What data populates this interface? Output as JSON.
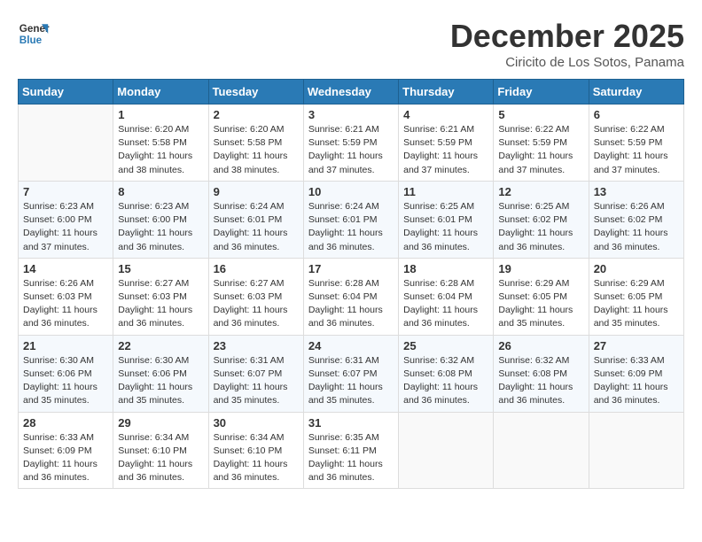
{
  "header": {
    "logo_general": "General",
    "logo_blue": "Blue",
    "month_title": "December 2025",
    "location": "Ciricito de Los Sotos, Panama"
  },
  "days_of_week": [
    "Sunday",
    "Monday",
    "Tuesday",
    "Wednesday",
    "Thursday",
    "Friday",
    "Saturday"
  ],
  "weeks": [
    [
      {
        "day": "",
        "info": ""
      },
      {
        "day": "1",
        "info": "Sunrise: 6:20 AM\nSunset: 5:58 PM\nDaylight: 11 hours\nand 38 minutes."
      },
      {
        "day": "2",
        "info": "Sunrise: 6:20 AM\nSunset: 5:58 PM\nDaylight: 11 hours\nand 38 minutes."
      },
      {
        "day": "3",
        "info": "Sunrise: 6:21 AM\nSunset: 5:59 PM\nDaylight: 11 hours\nand 37 minutes."
      },
      {
        "day": "4",
        "info": "Sunrise: 6:21 AM\nSunset: 5:59 PM\nDaylight: 11 hours\nand 37 minutes."
      },
      {
        "day": "5",
        "info": "Sunrise: 6:22 AM\nSunset: 5:59 PM\nDaylight: 11 hours\nand 37 minutes."
      },
      {
        "day": "6",
        "info": "Sunrise: 6:22 AM\nSunset: 5:59 PM\nDaylight: 11 hours\nand 37 minutes."
      }
    ],
    [
      {
        "day": "7",
        "info": "Sunrise: 6:23 AM\nSunset: 6:00 PM\nDaylight: 11 hours\nand 37 minutes."
      },
      {
        "day": "8",
        "info": "Sunrise: 6:23 AM\nSunset: 6:00 PM\nDaylight: 11 hours\nand 36 minutes."
      },
      {
        "day": "9",
        "info": "Sunrise: 6:24 AM\nSunset: 6:01 PM\nDaylight: 11 hours\nand 36 minutes."
      },
      {
        "day": "10",
        "info": "Sunrise: 6:24 AM\nSunset: 6:01 PM\nDaylight: 11 hours\nand 36 minutes."
      },
      {
        "day": "11",
        "info": "Sunrise: 6:25 AM\nSunset: 6:01 PM\nDaylight: 11 hours\nand 36 minutes."
      },
      {
        "day": "12",
        "info": "Sunrise: 6:25 AM\nSunset: 6:02 PM\nDaylight: 11 hours\nand 36 minutes."
      },
      {
        "day": "13",
        "info": "Sunrise: 6:26 AM\nSunset: 6:02 PM\nDaylight: 11 hours\nand 36 minutes."
      }
    ],
    [
      {
        "day": "14",
        "info": "Sunrise: 6:26 AM\nSunset: 6:03 PM\nDaylight: 11 hours\nand 36 minutes."
      },
      {
        "day": "15",
        "info": "Sunrise: 6:27 AM\nSunset: 6:03 PM\nDaylight: 11 hours\nand 36 minutes."
      },
      {
        "day": "16",
        "info": "Sunrise: 6:27 AM\nSunset: 6:03 PM\nDaylight: 11 hours\nand 36 minutes."
      },
      {
        "day": "17",
        "info": "Sunrise: 6:28 AM\nSunset: 6:04 PM\nDaylight: 11 hours\nand 36 minutes."
      },
      {
        "day": "18",
        "info": "Sunrise: 6:28 AM\nSunset: 6:04 PM\nDaylight: 11 hours\nand 36 minutes."
      },
      {
        "day": "19",
        "info": "Sunrise: 6:29 AM\nSunset: 6:05 PM\nDaylight: 11 hours\nand 35 minutes."
      },
      {
        "day": "20",
        "info": "Sunrise: 6:29 AM\nSunset: 6:05 PM\nDaylight: 11 hours\nand 35 minutes."
      }
    ],
    [
      {
        "day": "21",
        "info": "Sunrise: 6:30 AM\nSunset: 6:06 PM\nDaylight: 11 hours\nand 35 minutes."
      },
      {
        "day": "22",
        "info": "Sunrise: 6:30 AM\nSunset: 6:06 PM\nDaylight: 11 hours\nand 35 minutes."
      },
      {
        "day": "23",
        "info": "Sunrise: 6:31 AM\nSunset: 6:07 PM\nDaylight: 11 hours\nand 35 minutes."
      },
      {
        "day": "24",
        "info": "Sunrise: 6:31 AM\nSunset: 6:07 PM\nDaylight: 11 hours\nand 35 minutes."
      },
      {
        "day": "25",
        "info": "Sunrise: 6:32 AM\nSunset: 6:08 PM\nDaylight: 11 hours\nand 36 minutes."
      },
      {
        "day": "26",
        "info": "Sunrise: 6:32 AM\nSunset: 6:08 PM\nDaylight: 11 hours\nand 36 minutes."
      },
      {
        "day": "27",
        "info": "Sunrise: 6:33 AM\nSunset: 6:09 PM\nDaylight: 11 hours\nand 36 minutes."
      }
    ],
    [
      {
        "day": "28",
        "info": "Sunrise: 6:33 AM\nSunset: 6:09 PM\nDaylight: 11 hours\nand 36 minutes."
      },
      {
        "day": "29",
        "info": "Sunrise: 6:34 AM\nSunset: 6:10 PM\nDaylight: 11 hours\nand 36 minutes."
      },
      {
        "day": "30",
        "info": "Sunrise: 6:34 AM\nSunset: 6:10 PM\nDaylight: 11 hours\nand 36 minutes."
      },
      {
        "day": "31",
        "info": "Sunrise: 6:35 AM\nSunset: 6:11 PM\nDaylight: 11 hours\nand 36 minutes."
      },
      {
        "day": "",
        "info": ""
      },
      {
        "day": "",
        "info": ""
      },
      {
        "day": "",
        "info": ""
      }
    ]
  ]
}
